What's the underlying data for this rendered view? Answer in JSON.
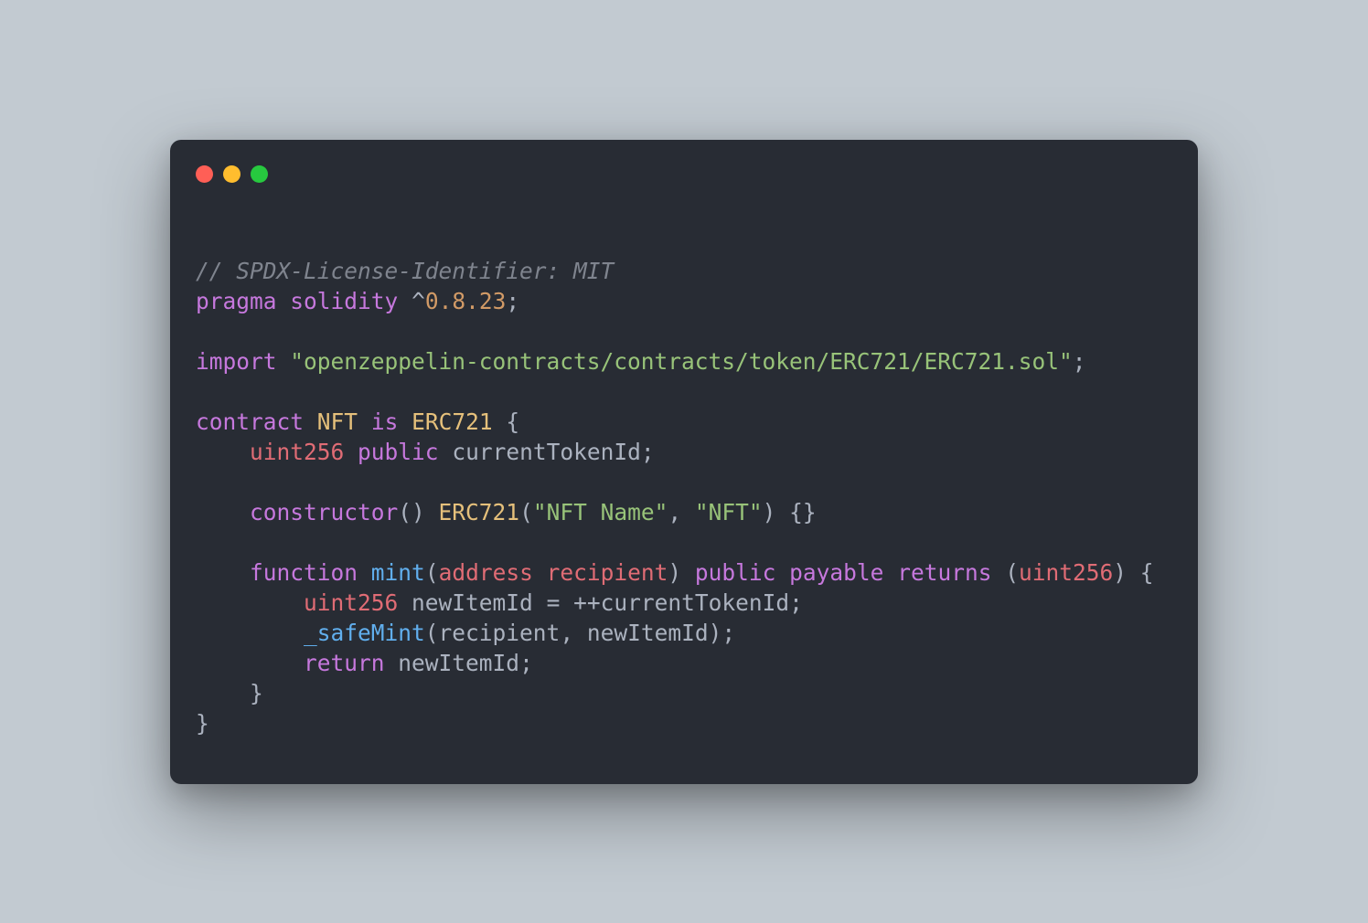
{
  "window": {
    "dots": [
      "red",
      "yellow",
      "green"
    ]
  },
  "code": {
    "l1": {
      "comment": "// SPDX-License-Identifier: MIT"
    },
    "l2": {
      "k1": "pragma",
      "k2": "solidity",
      "op": "^",
      "ver": "0.8.23",
      "semi": ";"
    },
    "l3": "",
    "l4": {
      "k": "import",
      "sp": " ",
      "str": "\"openzeppelin-contracts/contracts/token/ERC721/ERC721.sol\"",
      "semi": ";"
    },
    "l5": "",
    "l6": {
      "k1": "contract",
      "name": "NFT",
      "k2": "is",
      "base": "ERC721",
      "brace": " {"
    },
    "l7": {
      "indent": "    ",
      "type": "uint256",
      "vis": "public",
      "name": "currentTokenId",
      "semi": ";"
    },
    "l8": "",
    "l9": {
      "indent": "    ",
      "k": "constructor",
      "p1": "() ",
      "base": "ERC721",
      "p2": "(",
      "s1": "\"NFT Name\"",
      "comma": ", ",
      "s2": "\"NFT\"",
      "p3": ") {}"
    },
    "l10": "",
    "l11": {
      "indent": "    ",
      "k1": "function",
      "name": "mint",
      "p1": "(",
      "ptype": "address",
      "sp1": " ",
      "pname": "recipient",
      "p2": ") ",
      "vis": "public",
      "sp2": " ",
      "mut": "payable",
      "sp3": " ",
      "ret": "returns",
      "p3": " (",
      "rtype": "uint256",
      "p4": ") {"
    },
    "l12": {
      "indent": "        ",
      "type": "uint256",
      "sp1": " ",
      "var": "newItemId",
      "sp2": " ",
      "op1": "=",
      "sp3": " ",
      "op2": "++",
      "rhs": "currentTokenId",
      "semi": ";"
    },
    "l13": {
      "indent": "        ",
      "fn": "_safeMint",
      "p1": "(",
      "a1": "recipient",
      "comma": ", ",
      "a2": "newItemId",
      "p2": ");"
    },
    "l14": {
      "indent": "        ",
      "k": "return",
      "sp": " ",
      "v": "newItemId",
      "semi": ";"
    },
    "l15": {
      "indent": "    ",
      "brace": "}"
    },
    "l16": {
      "brace": "}"
    }
  }
}
